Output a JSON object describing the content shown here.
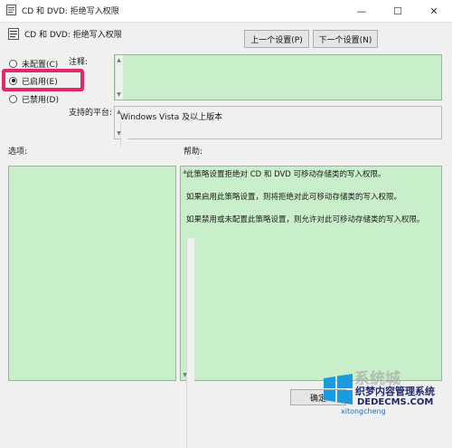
{
  "window": {
    "title": "CD 和 DVD: 拒绝写入权限",
    "minimize_glyph": "—",
    "maximize_glyph": "☐",
    "close_glyph": "✕"
  },
  "header": {
    "policy_name": "CD 和 DVD: 拒绝写入权限",
    "prev_button": "上一个设置(P)",
    "next_button": "下一个设置(N)"
  },
  "options": [
    {
      "label": "未配置(C)",
      "selected": false
    },
    {
      "label": "已启用(E)",
      "selected": true
    },
    {
      "label": "已禁用(D)",
      "selected": false
    }
  ],
  "comment_label": "注释:",
  "platform_label": "支持的平台:",
  "platform_value": "Windows Vista 及以上版本",
  "options_section_label": "选项:",
  "help_section_label": "帮助:",
  "help_paragraphs": [
    "此策略设置拒绝对 CD 和 DVD 可移动存储类的写入权限。",
    "如果启用此策略设置，则将拒绝对此可移动存储类的写入权限。",
    "如果禁用或未配置此策略设置，则允许对此可移动存储类的写入权限。"
  ],
  "footer": {
    "ok_button": "确定"
  },
  "watermark": {
    "brand": "系统城",
    "line1": "织梦内容管理系统",
    "line2": "DEDECMS.COM",
    "line3": "xitongcheng"
  },
  "colors": {
    "highlight": "#e2276e",
    "green_panel": "#c9efca"
  }
}
